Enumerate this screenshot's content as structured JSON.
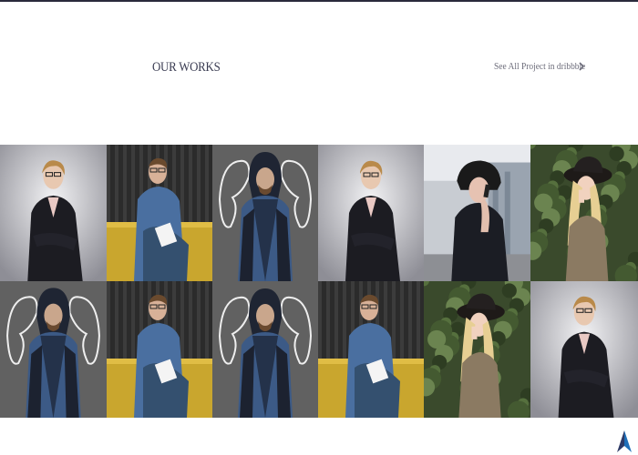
{
  "section": {
    "title": "OUR WORKS",
    "link_label": "See All Project in dribbble",
    "link_icon": "chevron-right-icon"
  },
  "gallery": {
    "tiles": [
      {
        "subject": "woman-glasses-blazer",
        "bg": "studio-gray"
      },
      {
        "subject": "man-writing-yellow-sofa",
        "bg": "dark-stripes"
      },
      {
        "subject": "hooded-man-chalk-arms",
        "bg": "chalkboard"
      },
      {
        "subject": "woman-glasses-blazer",
        "bg": "studio-gray"
      },
      {
        "subject": "woman-phone-black-hat",
        "bg": "city-street"
      },
      {
        "subject": "blonde-woman-hat",
        "bg": "green-foliage"
      },
      {
        "subject": "hooded-man-chalk-arms",
        "bg": "chalkboard"
      },
      {
        "subject": "man-writing-yellow-sofa",
        "bg": "dark-stripes"
      },
      {
        "subject": "hooded-man-chalk-arms",
        "bg": "chalkboard"
      },
      {
        "subject": "man-writing-yellow-sofa",
        "bg": "dark-stripes"
      },
      {
        "subject": "blonde-woman-hat",
        "bg": "green-foliage"
      },
      {
        "subject": "woman-glasses-blazer",
        "bg": "studio-gray"
      }
    ]
  },
  "colors": {
    "title": "#3a3c52",
    "link": "#6c6c7a",
    "top_bar": "#2a2a3c",
    "logo": "#1f6fb8"
  },
  "brand": {
    "icon": "brand-logo-icon"
  }
}
